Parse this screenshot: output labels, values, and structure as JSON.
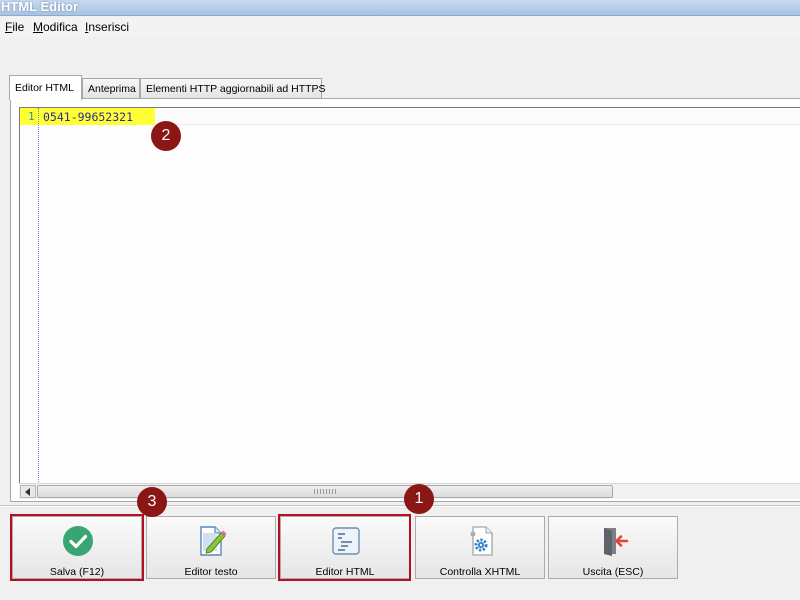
{
  "window": {
    "title": "HTML Editor"
  },
  "menu": {
    "items": [
      {
        "label": "File",
        "accel": "F",
        "rest": "ile"
      },
      {
        "label": "Modifica",
        "accel": "M",
        "rest": "odifica"
      },
      {
        "label": "Inserisci",
        "accel": "I",
        "rest": "nserisci"
      }
    ]
  },
  "tabs": [
    {
      "label": "Editor HTML",
      "active": true
    },
    {
      "label": "Anteprima",
      "active": false
    },
    {
      "label": "Elementi HTTP aggiornabili ad HTTPS",
      "active": false
    }
  ],
  "editor": {
    "lines": [
      {
        "number": "1",
        "text": "0541-99652321"
      }
    ]
  },
  "toolbar": {
    "buttons": [
      {
        "label": "Salva (F12)",
        "icon": "check-circle-icon"
      },
      {
        "label": "Editor testo",
        "icon": "document-pencil-icon"
      },
      {
        "label": "Editor HTML",
        "icon": "html-code-icon"
      },
      {
        "label": "Controlla XHTML",
        "icon": "document-gear-icon"
      },
      {
        "label": "Uscita (ESC)",
        "icon": "exit-door-icon"
      }
    ]
  },
  "annotations": [
    {
      "label": "1"
    },
    {
      "label": "2"
    },
    {
      "label": "3"
    }
  ],
  "colors": {
    "highlight_line": "#ffff33",
    "annotation": "#8b1616",
    "check_green": "#3aa574"
  }
}
